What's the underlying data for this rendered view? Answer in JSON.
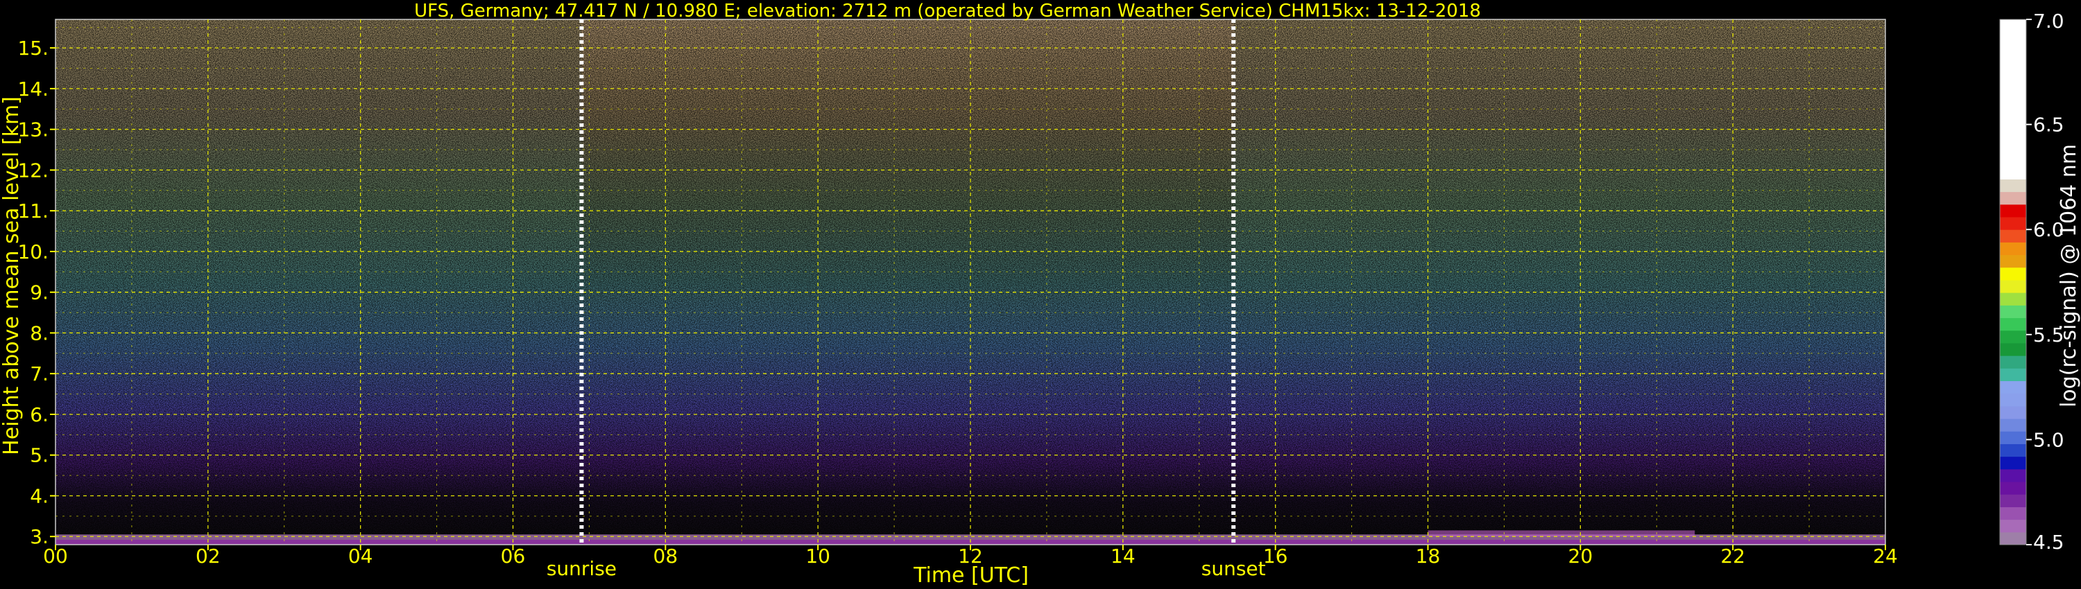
{
  "title": "UFS, Germany; 47.417 N / 10.980 E; elevation: 2712 m  (operated by German Weather Service)     CHM15kx: 13-12-2018",
  "chart_data": {
    "type": "heatmap",
    "title": "UFS, Germany; 47.417 N / 10.980 E; elevation: 2712 m  (operated by German Weather Service)     CHM15kx: 13-12-2018",
    "xlabel": "Time [UTC]",
    "ylabel": "Height above mean sea level [km]",
    "xlim": [
      0,
      24
    ],
    "ylim": [
      2.8,
      15.7
    ],
    "x_ticks": [
      0,
      2,
      4,
      6,
      8,
      10,
      12,
      14,
      16,
      18,
      20,
      22,
      24
    ],
    "x_tick_labels": [
      "00",
      "02",
      "04",
      "06",
      "08",
      "10",
      "12",
      "14",
      "16",
      "18",
      "20",
      "22",
      "24"
    ],
    "y_ticks": [
      3,
      4,
      5,
      6,
      7,
      8,
      9,
      10,
      11,
      12,
      13,
      14,
      15
    ],
    "y_tick_labels": [
      "3.",
      "4.",
      "5.",
      "6.",
      "7.",
      "8.",
      "9.",
      "10.",
      "11.",
      "12.",
      "13.",
      "14.",
      "15."
    ],
    "grid": true,
    "markers": [
      {
        "label": "sunrise",
        "x": 6.9
      },
      {
        "label": "sunset",
        "x": 15.45
      }
    ],
    "colorbar": {
      "label": "log(rc-signal) @ 1064 nm",
      "range": [
        4.5,
        7.0
      ],
      "ticks": [
        4.5,
        5.0,
        5.5,
        6.0,
        6.5,
        7.0
      ],
      "tick_labels": [
        "4.5",
        "5.0",
        "5.5",
        "6.0",
        "6.5",
        "7.0"
      ],
      "levels": [
        {
          "from": 4.5,
          "to": 4.56,
          "color": "#9e7fa8"
        },
        {
          "from": 4.56,
          "to": 4.62,
          "color": "#a86bb8"
        },
        {
          "from": 4.62,
          "to": 4.68,
          "color": "#9a52b0"
        },
        {
          "from": 4.68,
          "to": 4.74,
          "color": "#7a2aa0"
        },
        {
          "from": 4.74,
          "to": 4.8,
          "color": "#6a12a0"
        },
        {
          "from": 4.8,
          "to": 4.86,
          "color": "#5a10a8"
        },
        {
          "from": 4.86,
          "to": 4.92,
          "color": "#0c14b8"
        },
        {
          "from": 4.92,
          "to": 4.98,
          "color": "#2848c8"
        },
        {
          "from": 4.98,
          "to": 5.04,
          "color": "#5070d8"
        },
        {
          "from": 5.04,
          "to": 5.1,
          "color": "#7088e0"
        },
        {
          "from": 5.1,
          "to": 5.16,
          "color": "#8898e8"
        },
        {
          "from": 5.16,
          "to": 5.22,
          "color": "#8aa0ec"
        },
        {
          "from": 5.22,
          "to": 5.28,
          "color": "#8aa4ee"
        },
        {
          "from": 5.28,
          "to": 5.34,
          "color": "#40b8a0"
        },
        {
          "from": 5.34,
          "to": 5.4,
          "color": "#30a880"
        },
        {
          "from": 5.4,
          "to": 5.46,
          "color": "#189838"
        },
        {
          "from": 5.46,
          "to": 5.52,
          "color": "#20a840"
        },
        {
          "from": 5.52,
          "to": 5.58,
          "color": "#38c858"
        },
        {
          "from": 5.58,
          "to": 5.64,
          "color": "#58d870"
        },
        {
          "from": 5.64,
          "to": 5.7,
          "color": "#a0e040"
        },
        {
          "from": 5.7,
          "to": 5.76,
          "color": "#e8f020"
        },
        {
          "from": 5.76,
          "to": 5.82,
          "color": "#f8f800"
        },
        {
          "from": 5.82,
          "to": 5.88,
          "color": "#e8a010"
        },
        {
          "from": 5.88,
          "to": 5.94,
          "color": "#f09010"
        },
        {
          "from": 5.94,
          "to": 6.0,
          "color": "#f05020"
        },
        {
          "from": 6.0,
          "to": 6.06,
          "color": "#e82010"
        },
        {
          "from": 6.06,
          "to": 6.12,
          "color": "#e00000"
        },
        {
          "from": 6.12,
          "to": 6.18,
          "color": "#e0b0a8"
        },
        {
          "from": 6.18,
          "to": 6.24,
          "color": "#e0d8c8"
        },
        {
          "from": 6.24,
          "to": 7.0,
          "color": "#ffffff"
        }
      ]
    }
  }
}
